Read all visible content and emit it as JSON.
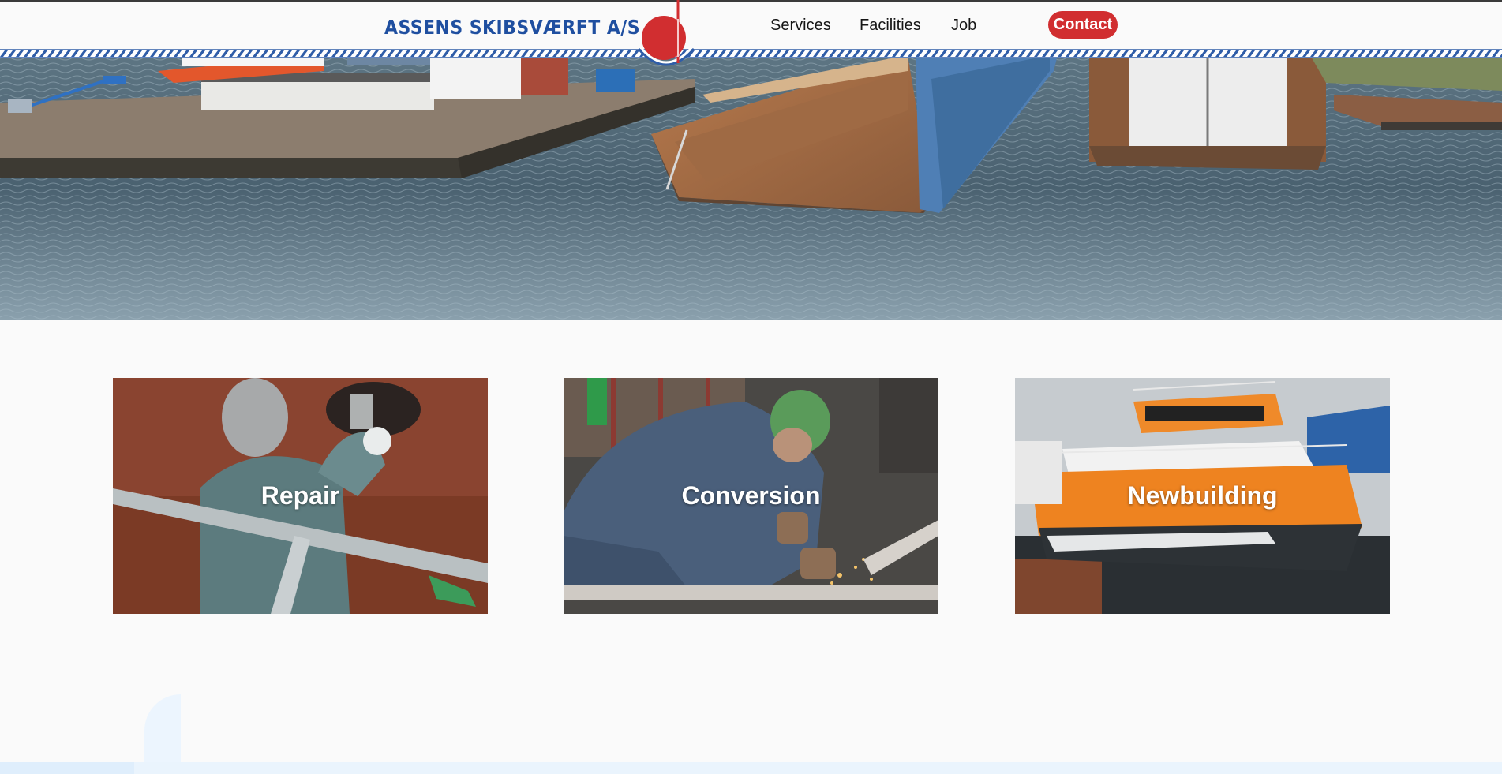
{
  "header": {
    "logo_text": "ASSENS SKIBSVÆRFT A/S",
    "nav": {
      "services": "Services",
      "facilities": "Facilities",
      "job": "Job",
      "contact": "Contact"
    }
  },
  "hero": {
    "image": "shipyard-floating-docks-photo"
  },
  "cards": [
    {
      "label": "Repair",
      "image": "welder-grinding-photo"
    },
    {
      "label": "Conversion",
      "image": "worker-cutting-metal-photo"
    },
    {
      "label": "Newbuilding",
      "image": "orange-catamaran-vessel-photo"
    }
  ],
  "colors": {
    "brand_blue": "#1f4fa0",
    "accent_red": "#d12e30",
    "background": "#fafafa"
  }
}
